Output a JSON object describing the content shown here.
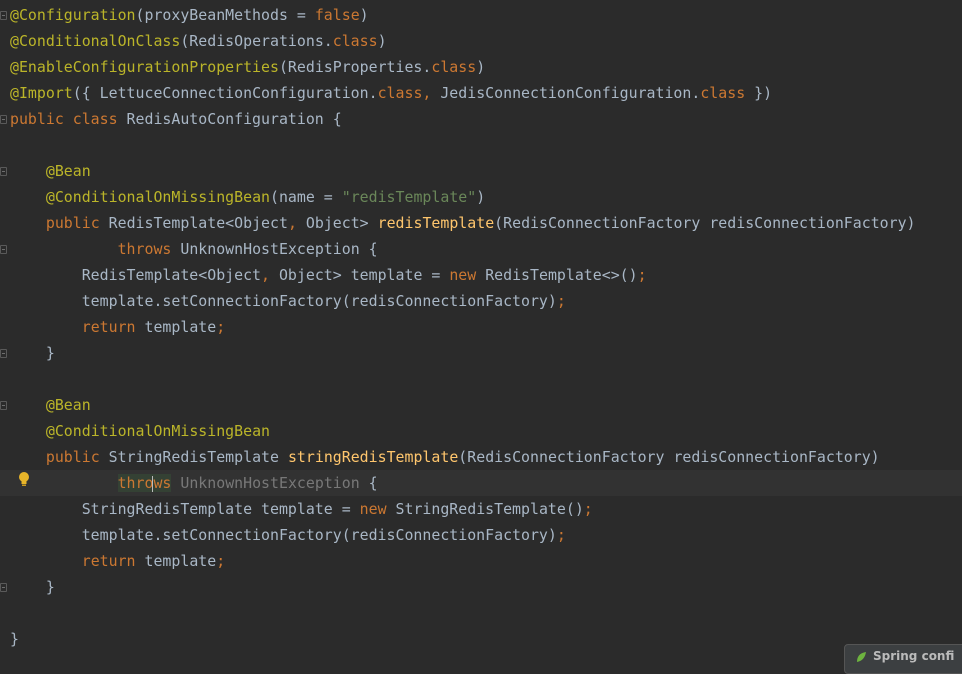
{
  "editor": {
    "lines": [
      [
        [
          "ann",
          "@Configuration"
        ],
        [
          "txt",
          "(proxyBeanMethods = "
        ],
        [
          "kw",
          "false"
        ],
        [
          "txt",
          ")"
        ]
      ],
      [
        [
          "ann",
          "@ConditionalOnClass"
        ],
        [
          "txt",
          "(RedisOperations."
        ],
        [
          "kw",
          "class"
        ],
        [
          "txt",
          ")"
        ]
      ],
      [
        [
          "ann",
          "@EnableConfigurationProperties"
        ],
        [
          "txt",
          "(RedisProperties."
        ],
        [
          "kw",
          "class"
        ],
        [
          "txt",
          ")"
        ]
      ],
      [
        [
          "ann",
          "@Import"
        ],
        [
          "txt",
          "({ LettuceConnectionConfiguration."
        ],
        [
          "kw",
          "class"
        ],
        [
          "punc",
          ", "
        ],
        [
          "txt",
          "JedisConnectionConfiguration."
        ],
        [
          "kw",
          "class"
        ],
        [
          "txt",
          " })"
        ]
      ],
      [
        [
          "kw",
          "public class "
        ],
        [
          "txt",
          "RedisAutoConfiguration {"
        ]
      ],
      [],
      [
        [
          "txt",
          "    "
        ],
        [
          "ann",
          "@Bean"
        ]
      ],
      [
        [
          "txt",
          "    "
        ],
        [
          "ann",
          "@ConditionalOnMissingBean"
        ],
        [
          "txt",
          "(name = "
        ],
        [
          "str",
          "\"redisTemplate\""
        ],
        [
          "txt",
          ")"
        ]
      ],
      [
        [
          "txt",
          "    "
        ],
        [
          "kw",
          "public "
        ],
        [
          "txt",
          "RedisTemplate<Object"
        ],
        [
          "punc",
          ", "
        ],
        [
          "txt",
          "Object> "
        ],
        [
          "fn",
          "redisTemplate"
        ],
        [
          "txt",
          "(RedisConnectionFactory redisConnectionFactory)"
        ]
      ],
      [
        [
          "txt",
          "            "
        ],
        [
          "kw",
          "throws "
        ],
        [
          "txt",
          "UnknownHostException {"
        ]
      ],
      [
        [
          "txt",
          "        RedisTemplate<Object"
        ],
        [
          "punc",
          ", "
        ],
        [
          "txt",
          "Object> template = "
        ],
        [
          "kw",
          "new "
        ],
        [
          "txt",
          "RedisTemplate<>()"
        ],
        [
          "punc",
          ";"
        ]
      ],
      [
        [
          "txt",
          "        template.setConnectionFactory(redisConnectionFactory)"
        ],
        [
          "punc",
          ";"
        ]
      ],
      [
        [
          "txt",
          "        "
        ],
        [
          "kw",
          "return "
        ],
        [
          "txt",
          "template"
        ],
        [
          "punc",
          ";"
        ]
      ],
      [
        [
          "txt",
          "    }"
        ]
      ],
      [],
      [
        [
          "txt",
          "    "
        ],
        [
          "ann",
          "@Bean"
        ]
      ],
      [
        [
          "txt",
          "    "
        ],
        [
          "ann",
          "@ConditionalOnMissingBean"
        ]
      ],
      [
        [
          "txt",
          "    "
        ],
        [
          "kw",
          "public "
        ],
        [
          "txt",
          "StringRedisTemplate "
        ],
        [
          "fn",
          "stringRedisTemplate"
        ],
        [
          "txt",
          "(RedisConnectionFactory redisConnectionFactory)"
        ]
      ],
      [
        [
          "txt",
          "            "
        ],
        [
          "kw-hl",
          "thro"
        ],
        [
          "caret",
          ""
        ],
        [
          "kw-hl",
          "ws"
        ],
        [
          "txt",
          " "
        ],
        [
          "unused",
          "UnknownHostException"
        ],
        [
          "txt",
          " {"
        ]
      ],
      [
        [
          "txt",
          "        StringRedisTemplate template = "
        ],
        [
          "kw",
          "new "
        ],
        [
          "txt",
          "StringRedisTemplate()"
        ],
        [
          "punc",
          ";"
        ]
      ],
      [
        [
          "txt",
          "        template.setConnectionFactory(redisConnectionFactory)"
        ],
        [
          "punc",
          ";"
        ]
      ],
      [
        [
          "txt",
          "        "
        ],
        [
          "kw",
          "return "
        ],
        [
          "txt",
          "template"
        ],
        [
          "punc",
          ";"
        ]
      ],
      [
        [
          "txt",
          "    }"
        ]
      ],
      [],
      [
        [
          "txt",
          "}"
        ]
      ]
    ],
    "current_line": 18
  },
  "gutter": {
    "fold_markers": [
      0,
      4,
      6,
      9,
      13,
      15,
      18,
      22
    ],
    "intention_icon": "lightbulb-icon"
  },
  "popup": {
    "label": "Spring confi",
    "icon": "spring-leaf-icon"
  },
  "colors": {
    "background": "#2b2b2b",
    "annotation": "#bbb529",
    "keyword": "#cc7832",
    "string": "#6a8759",
    "method": "#ffc66d",
    "text": "#a9b7c6"
  }
}
